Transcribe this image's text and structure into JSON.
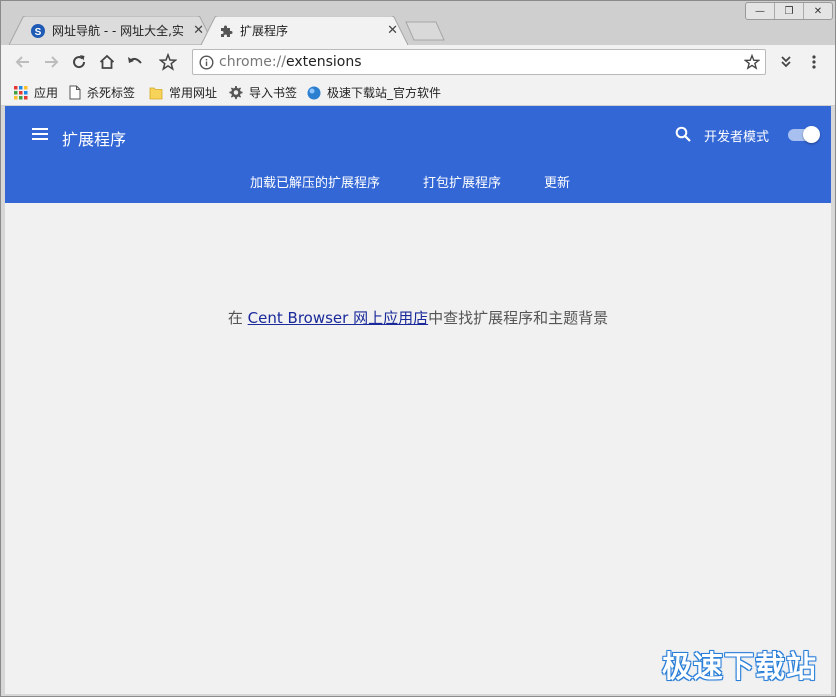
{
  "tabs": [
    {
      "title": "网址导航 - - 网址大全,实",
      "close": "✕",
      "active": false
    },
    {
      "title": "扩展程序",
      "close": "✕",
      "active": true
    }
  ],
  "window_controls": {
    "minimize": "—",
    "restore": "❐",
    "close": "✕"
  },
  "toolbar": {
    "url_scheme": "chrome://",
    "url_host": "extensions"
  },
  "bookmarks": [
    {
      "label": "应用",
      "icon": "apps-grid-icon"
    },
    {
      "label": "杀死标签",
      "icon": "page-icon"
    },
    {
      "label": "常用网址",
      "icon": "folder-icon"
    },
    {
      "label": "导入书签",
      "icon": "gear-icon"
    },
    {
      "label": "极速下载站_官方软件",
      "icon": "site-favicon-icon"
    }
  ],
  "header": {
    "title": "扩展程序",
    "developer_mode_label": "开发者模式",
    "developer_mode_on": true,
    "buttons": [
      "加载已解压的扩展程序",
      "打包扩展程序",
      "更新"
    ]
  },
  "main": {
    "prefix": "在 ",
    "store_link": "Cent Browser 网上应用店",
    "suffix": "中查找扩展程序和主题背景"
  },
  "watermark": "极速下载站",
  "colors": {
    "header_bg": "#3367d6",
    "page_bg": "#f1f1f1",
    "link": "#1a2a9a"
  }
}
